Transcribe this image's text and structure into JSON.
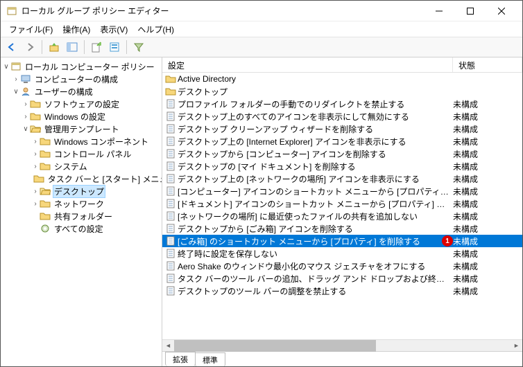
{
  "window": {
    "title": "ローカル グループ ポリシー エディター"
  },
  "menu": {
    "file": "ファイル(F)",
    "action": "操作(A)",
    "view": "表示(V)",
    "help": "ヘルプ(H)"
  },
  "tree": {
    "root": "ローカル コンピューター ポリシー",
    "computer_config": "コンピューターの構成",
    "user_config": "ユーザーの構成",
    "software": "ソフトウェアの設定",
    "windows": "Windows の設定",
    "admin_templates": "管理用テンプレート",
    "win_components": "Windows コンポーネント",
    "control_panel": "コントロール パネル",
    "system": "システム",
    "taskbar_start": "タスク バーと [スタート] メニュー",
    "desktop": "デスクトップ",
    "network": "ネットワーク",
    "shared_folder": "共有フォルダー",
    "all_settings": "すべての設定"
  },
  "columns": {
    "setting": "設定",
    "state": "状態"
  },
  "state_label": "未構成",
  "rows": [
    {
      "type": "folder",
      "label": "Active Directory",
      "state": ""
    },
    {
      "type": "folder",
      "label": "デスクトップ",
      "state": ""
    },
    {
      "type": "policy",
      "label": "プロファイル フォルダーの手動でのリダイレクトを禁止する",
      "state": "未構成"
    },
    {
      "type": "policy",
      "label": "デスクトップ上のすべてのアイコンを非表示にして無効にする",
      "state": "未構成"
    },
    {
      "type": "policy",
      "label": "デスクトップ クリーンアップ ウィザードを削除する",
      "state": "未構成"
    },
    {
      "type": "policy",
      "label": "デスクトップ上の [Internet Explorer] アイコンを非表示にする",
      "state": "未構成"
    },
    {
      "type": "policy",
      "label": "デスクトップから [コンピューター] アイコンを削除する",
      "state": "未構成"
    },
    {
      "type": "policy",
      "label": "デスクトップの [マイ ドキュメント] を削除する",
      "state": "未構成"
    },
    {
      "type": "policy",
      "label": "デスクトップ上の [ネットワークの場所] アイコンを非表示にする",
      "state": "未構成"
    },
    {
      "type": "policy",
      "label": "[コンピューター] アイコンのショートカット メニューから [プロパティ] を削",
      "state": "未構成"
    },
    {
      "type": "policy",
      "label": "[ドキュメント] アイコンのショートカット メニューから [プロパティ] を削除",
      "state": "未構成"
    },
    {
      "type": "policy",
      "label": "[ネットワークの場所] に最近使ったファイルの共有を追加しない",
      "state": "未構成"
    },
    {
      "type": "policy",
      "label": "デスクトップから [ごみ箱] アイコンを削除する",
      "state": "未構成"
    },
    {
      "type": "policy",
      "label": "[ごみ箱] のショートカット メニューから [プロパティ] を削除する",
      "state": "未構成",
      "selected": true,
      "badge": "1"
    },
    {
      "type": "policy",
      "label": "終了時に設定を保存しない",
      "state": "未構成"
    },
    {
      "type": "policy",
      "label": "Aero Shake のウィンドウ最小化のマウス ジェスチャをオフにする",
      "state": "未構成"
    },
    {
      "type": "policy",
      "label": "タスク バーのツール バーの追加、ドラッグ アンド ドロップおよび終了を…",
      "state": "未構成"
    },
    {
      "type": "policy",
      "label": "デスクトップのツール バーの調整を禁止する",
      "state": "未構成"
    }
  ],
  "tabs": {
    "extended": "拡張",
    "standard": "標準"
  }
}
